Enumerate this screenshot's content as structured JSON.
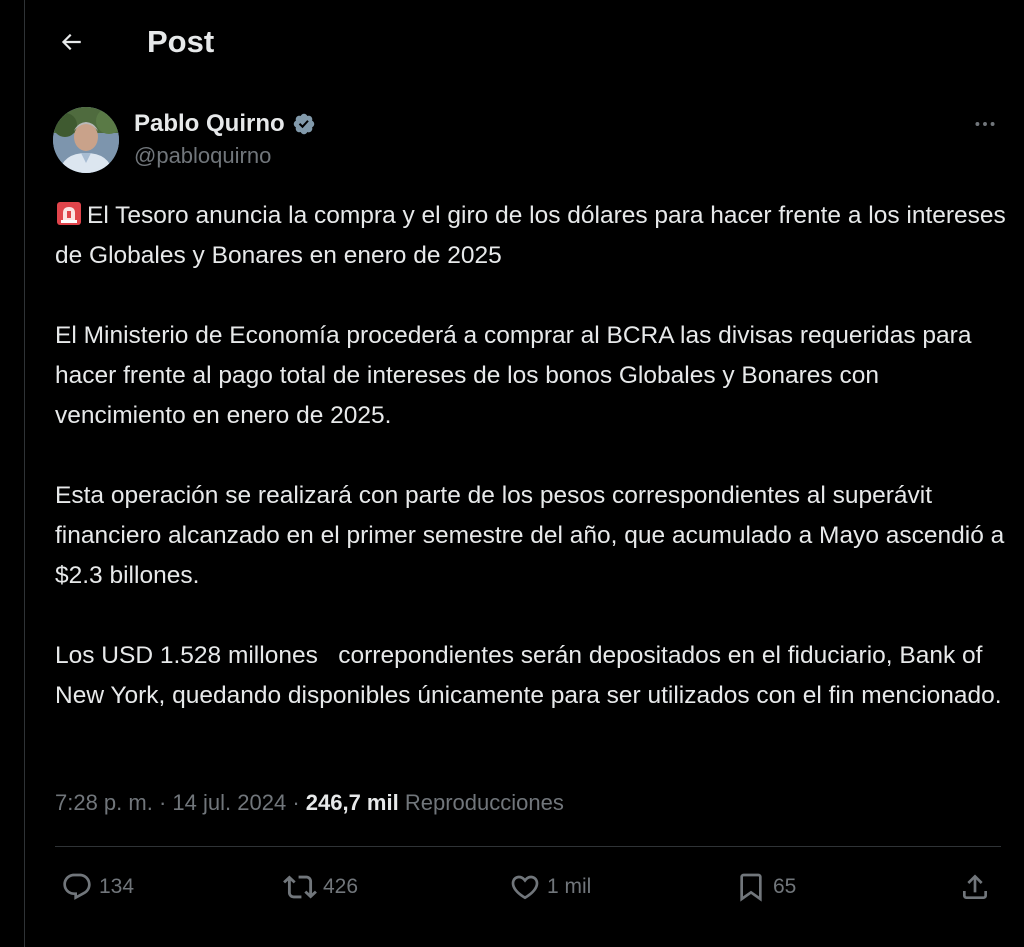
{
  "header": {
    "title": "Post",
    "back_icon": "arrow-left-icon"
  },
  "author": {
    "name": "Pablo Quirno",
    "handle": "@pabloquirno",
    "verified": true,
    "verified_color": "#1d9bf0"
  },
  "tweet": {
    "paragraphs": [
      "El Tesoro anuncia la compra y el giro de los dólares para hacer frente a los intereses de Globales y Bonares en enero de 2025",
      "El Ministerio de Economía procederá a comprar al BCRA las divisas requeridas para hacer frente al pago total de intereses de los bonos Globales y Bonares con vencimiento en enero de 2025.",
      "Esta operación se realizará con parte de los pesos correspondientes al superávit financiero alcanzado en el primer semestre del año, que acumulado a Mayo ascendió a $2.3 billones.",
      "Los USD 1.528 millones   correpondientes serán depositados en el fiduciario, Bank of New York, quedando disponibles únicamente para ser utilizados con el fin mencionado."
    ],
    "leading_emoji": "rotating-light-emoji"
  },
  "meta": {
    "time": "7:28 p. m.",
    "separator": "·",
    "date": "14 jul. 2024",
    "views_count": "246,7 mil",
    "views_label": "Reproducciones"
  },
  "actions": {
    "replies": "134",
    "reposts": "426",
    "likes": "1 mil",
    "bookmarks": "65"
  },
  "colors": {
    "background": "#000000",
    "text_primary": "#e7e9ea",
    "text_secondary": "#71767b",
    "border": "#2f3336"
  }
}
